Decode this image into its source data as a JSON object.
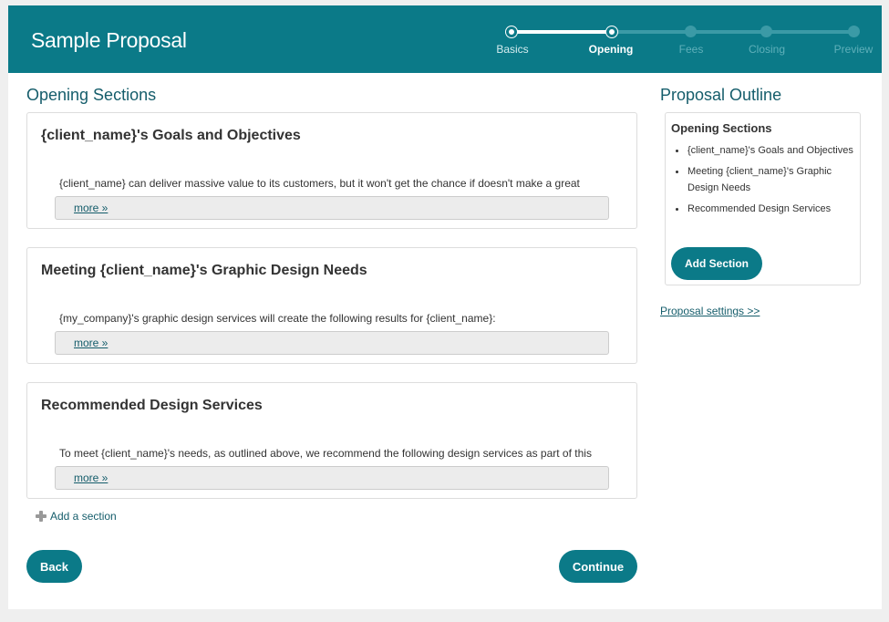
{
  "header": {
    "title": "Sample Proposal"
  },
  "stepper": {
    "steps": [
      {
        "label": "Basics",
        "state": "done"
      },
      {
        "label": "Opening",
        "state": "current"
      },
      {
        "label": "Fees",
        "state": "upcoming"
      },
      {
        "label": "Closing",
        "state": "upcoming"
      },
      {
        "label": "Preview",
        "state": "upcoming"
      }
    ]
  },
  "main": {
    "heading": "Opening Sections",
    "sections": [
      {
        "title": "{client_name}'s Goals and Objectives",
        "body": "{client_name} can deliver massive value to its customers, but it won't get the chance if doesn't make a great",
        "more": "more »"
      },
      {
        "title": "Meeting {client_name}'s Graphic Design Needs",
        "body": "{my_company}'s graphic design services will create the following results for {client_name}:",
        "more": "more »"
      },
      {
        "title": "Recommended Design Services",
        "body": "To meet {client_name}'s needs, as outlined above, we recommend the following design services as part of this",
        "more": "more »"
      }
    ],
    "add_section": "Add a section",
    "back_label": "Back",
    "continue_label": "Continue"
  },
  "sidebar": {
    "heading": "Proposal Outline",
    "outline_title": "Opening Sections",
    "items": [
      "{client_name}'s Goals and Objectives",
      "Meeting {client_name}'s Graphic Design Needs",
      "Recommended Design Services"
    ],
    "add_section_button": "Add Section",
    "settings_link": "Proposal settings >>"
  },
  "colors": {
    "brand": "#0b7a88",
    "heading": "#155d6b"
  }
}
